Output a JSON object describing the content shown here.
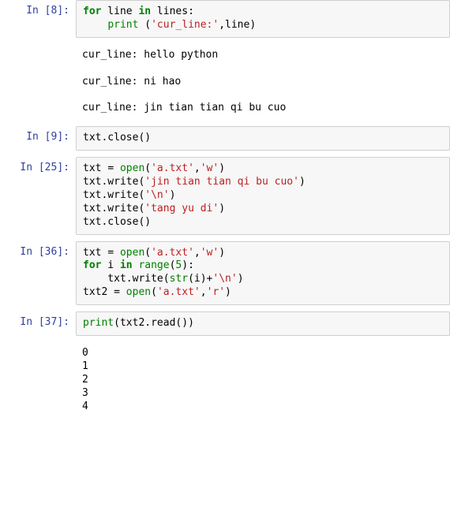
{
  "cells": [
    {
      "prompt": "In  [8]:",
      "code": [
        [
          {
            "c": "kw",
            "t": "for"
          },
          {
            "c": "text",
            "t": " line "
          },
          {
            "c": "kw",
            "t": "in"
          },
          {
            "c": "text",
            "t": " lines:"
          }
        ],
        [
          {
            "c": "text",
            "t": "    "
          },
          {
            "c": "bi",
            "t": "print"
          },
          {
            "c": "text",
            "t": " ("
          },
          {
            "c": "str",
            "t": "'cur_line:'"
          },
          {
            "c": "text",
            "t": ",line)"
          }
        ]
      ],
      "output": "cur_line: hello python\n\ncur_line: ni hao\n\ncur_line: jin tian tian qi bu cuo"
    },
    {
      "prompt": "In  [9]:",
      "code": [
        [
          {
            "c": "text",
            "t": "txt.close"
          },
          {
            "c": "paren",
            "t": "()"
          }
        ]
      ]
    },
    {
      "prompt": "In [25]:",
      "code": [
        [
          {
            "c": "text",
            "t": "txt "
          },
          {
            "c": "text",
            "t": "= "
          },
          {
            "c": "bi",
            "t": "open"
          },
          {
            "c": "text",
            "t": "("
          },
          {
            "c": "str",
            "t": "'a.txt'"
          },
          {
            "c": "text",
            "t": ","
          },
          {
            "c": "str",
            "t": "'w'"
          },
          {
            "c": "text",
            "t": ")"
          }
        ],
        [
          {
            "c": "text",
            "t": "txt.write("
          },
          {
            "c": "str",
            "t": "'jin tian tian qi bu cuo'"
          },
          {
            "c": "text",
            "t": ")"
          }
        ],
        [
          {
            "c": "text",
            "t": "txt.write("
          },
          {
            "c": "str",
            "t": "'\\n'"
          },
          {
            "c": "text",
            "t": ")"
          }
        ],
        [
          {
            "c": "text",
            "t": "txt.write("
          },
          {
            "c": "str",
            "t": "'tang yu di'"
          },
          {
            "c": "text",
            "t": ")"
          }
        ],
        [
          {
            "c": "text",
            "t": "txt.close"
          },
          {
            "c": "paren",
            "t": "()"
          }
        ]
      ]
    },
    {
      "prompt": "In [36]:",
      "code": [
        [
          {
            "c": "text",
            "t": "txt "
          },
          {
            "c": "text",
            "t": "= "
          },
          {
            "c": "bi",
            "t": "open"
          },
          {
            "c": "text",
            "t": "("
          },
          {
            "c": "str",
            "t": "'a.txt'"
          },
          {
            "c": "text",
            "t": ","
          },
          {
            "c": "str",
            "t": "'w'"
          },
          {
            "c": "text",
            "t": ")"
          }
        ],
        [
          {
            "c": "kw",
            "t": "for"
          },
          {
            "c": "text",
            "t": " i "
          },
          {
            "c": "kw",
            "t": "in"
          },
          {
            "c": "text",
            "t": " "
          },
          {
            "c": "bi",
            "t": "range"
          },
          {
            "c": "text",
            "t": "("
          },
          {
            "c": "num",
            "t": "5"
          },
          {
            "c": "text",
            "t": "):"
          }
        ],
        [
          {
            "c": "text",
            "t": "    txt.write("
          },
          {
            "c": "bi",
            "t": "str"
          },
          {
            "c": "text",
            "t": "(i)"
          },
          {
            "c": "text",
            "t": "+"
          },
          {
            "c": "str",
            "t": "'\\n'"
          },
          {
            "c": "text",
            "t": ")"
          }
        ],
        [
          {
            "c": "text",
            "t": "txt2 "
          },
          {
            "c": "text",
            "t": "= "
          },
          {
            "c": "bi",
            "t": "open"
          },
          {
            "c": "text",
            "t": "("
          },
          {
            "c": "str",
            "t": "'a.txt'"
          },
          {
            "c": "text",
            "t": ","
          },
          {
            "c": "str",
            "t": "'r'"
          },
          {
            "c": "text",
            "t": ")"
          }
        ]
      ]
    },
    {
      "prompt": "In [37]:",
      "code": [
        [
          {
            "c": "bi",
            "t": "print"
          },
          {
            "c": "text",
            "t": "(txt2.read"
          },
          {
            "c": "paren",
            "t": "()"
          },
          {
            "c": "text",
            "t": ")"
          }
        ]
      ],
      "output": "0\n1\n2\n3\n4"
    }
  ]
}
